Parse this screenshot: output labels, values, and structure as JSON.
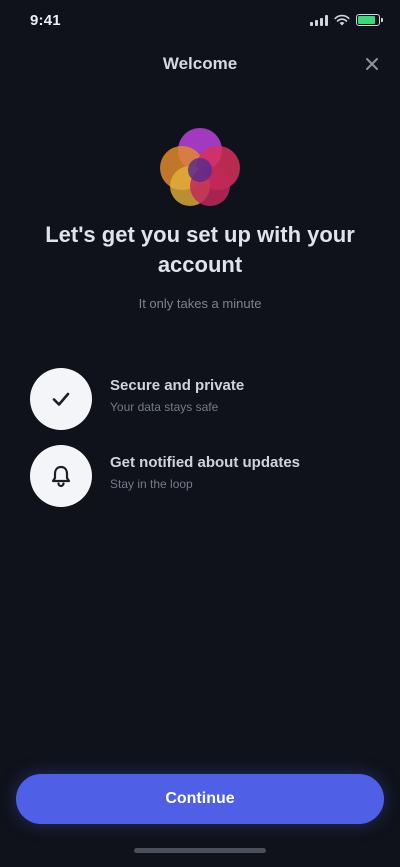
{
  "status_bar": {
    "time": "9:41",
    "battery_level": 0.9,
    "battery_color": "#39d97a"
  },
  "header": {
    "title": "Welcome",
    "close_icon": "close-icon"
  },
  "hero": {
    "logo_icon": "multicolor-flower-logo",
    "heading": "Let's get you set up with your account",
    "subtitle": "It only takes a minute"
  },
  "features": [
    {
      "icon": "checkmark-icon",
      "title": "Secure and private",
      "description": "Your data stays safe"
    },
    {
      "icon": "bell-icon",
      "title": "Get notified about updates",
      "description": "Stay in the loop"
    }
  ],
  "actions": {
    "primary_label": "Continue"
  },
  "colors": {
    "background": "#0f121a",
    "accent": "#4f5fe6"
  }
}
